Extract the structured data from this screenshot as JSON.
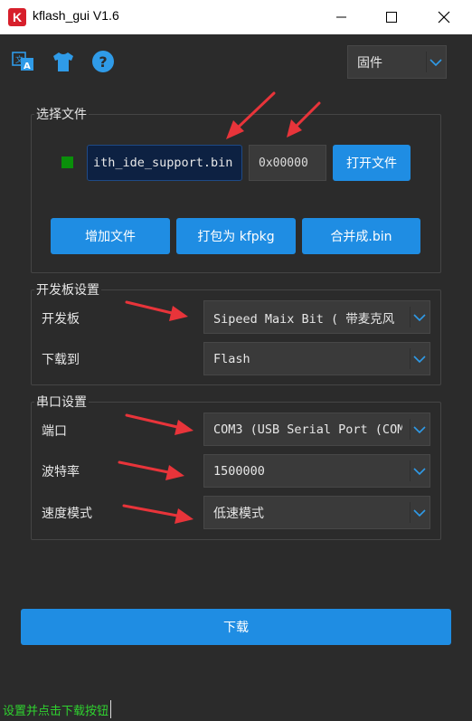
{
  "window": {
    "title": "kflash_gui V1.6",
    "logo_letter": "K"
  },
  "toolbar": {
    "icons": [
      "translate-icon",
      "shirt-icon",
      "help-icon"
    ],
    "mode_select": "固件"
  },
  "file_section": {
    "label": "选择文件",
    "file_path": "ith_ide_support.bin",
    "address": "0x00000",
    "open_button": "打开文件",
    "add_button": "增加文件",
    "pack_button": "打包为 kfpkg",
    "merge_button": "合并成.bin",
    "status_color": "#0a8f0a"
  },
  "board_section": {
    "label": "开发板设置",
    "board_label": "开发板",
    "board_value": "Sipeed Maix Bit ( 带麦克风",
    "download_to_label": "下载到",
    "download_to_value": "Flash"
  },
  "serial_section": {
    "label": "串口设置",
    "port_label": "端口",
    "port_value": "COM3 (USB Serial Port (COM",
    "baud_label": "波特率",
    "baud_value": "1500000",
    "speed_label": "速度模式",
    "speed_value": "低速模式"
  },
  "download_button": "下载",
  "status_text": "设置并点击下载按钮",
  "colors": {
    "accent": "#1f8de3",
    "background": "#2b2b2b",
    "arrow": "#e8343a",
    "status": "#2fd12f"
  }
}
